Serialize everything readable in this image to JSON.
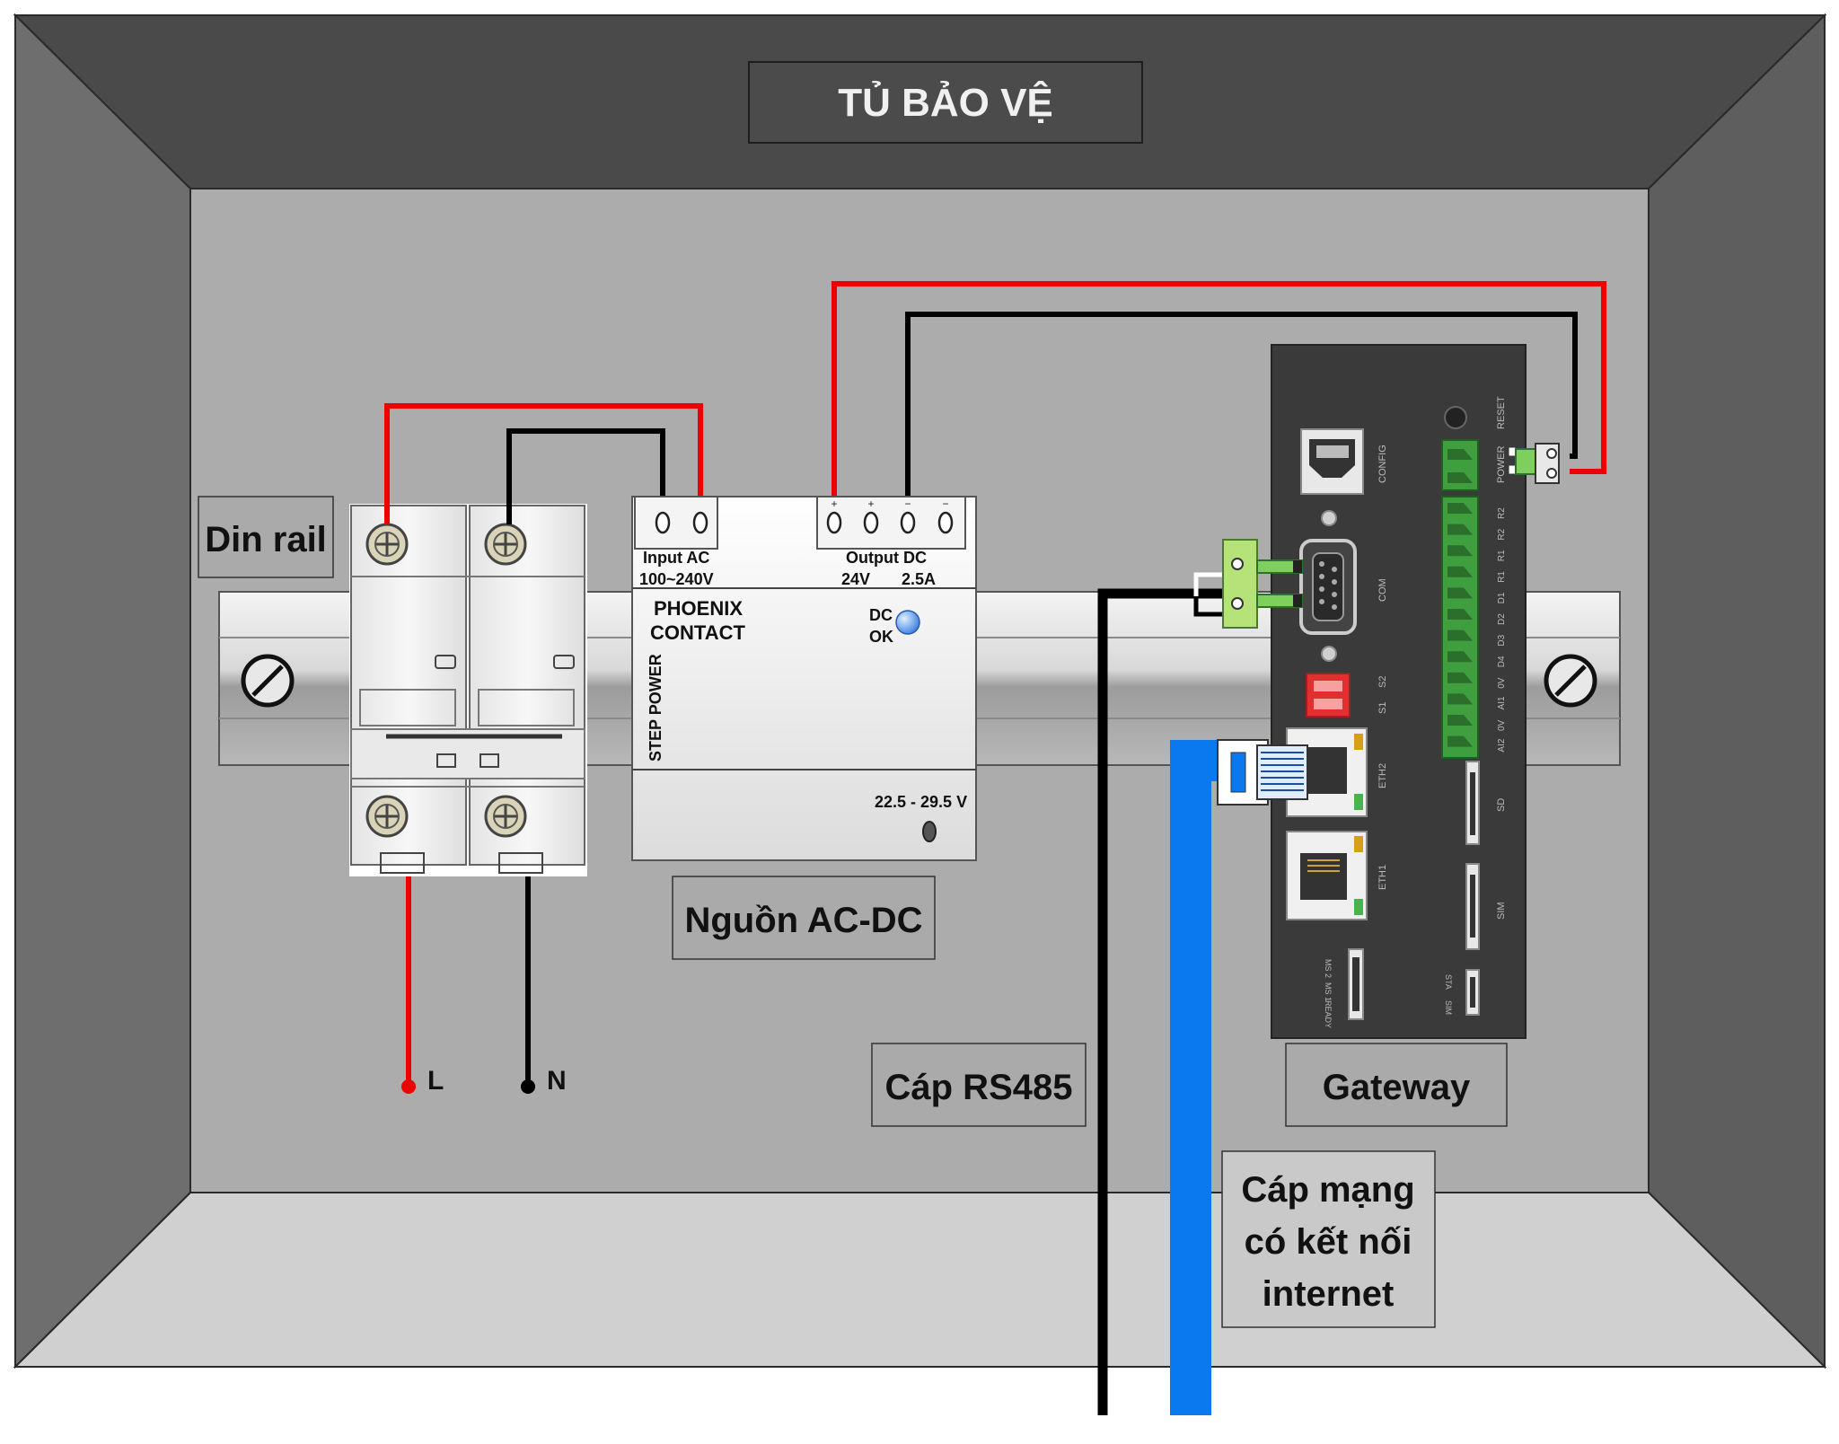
{
  "cabinet_title": "TỦ BẢO VỆ",
  "captions": {
    "din_rail": "Din rail",
    "power_supply": "Nguồn AC-DC",
    "rs485_cable": "Cáp RS485",
    "gateway": "Gateway",
    "network_cable_line1": "Cáp mạng",
    "network_cable_line2": "có kết nối",
    "network_cable_line3": "internet"
  },
  "terminals": {
    "live": "L",
    "neutral": "N"
  },
  "psu": {
    "input_label": "Input AC",
    "input_range": "100~240V",
    "output_label": "Output DC",
    "output_voltage": "24V",
    "output_current": "2.5A",
    "brand_line1": "PHOENIX",
    "brand_line2": "CONTACT",
    "series": "STEP POWER",
    "status_line1": "DC",
    "status_line2": "OK",
    "adjust_range": "22.5 - 29.5 V",
    "plus": "+",
    "minus": "−"
  },
  "gateway_labels": {
    "config": "CONFIG",
    "com": "COM",
    "s1": "S1",
    "s2": "S2",
    "eth2": "ETH2",
    "eth1": "ETH1",
    "reset": "RESET",
    "power": "POWER",
    "io": [
      "R2",
      "R2",
      "R1",
      "R1",
      "D1",
      "D2",
      "D3",
      "D4",
      "0V",
      "AI1",
      "0V",
      "AI2"
    ],
    "sd": "SD",
    "sim": "SIM",
    "ms2": "MS 2",
    "ms1": "MS 1",
    "ready": "READY",
    "sta": "STA",
    "sim_led": "SIM"
  },
  "colors": {
    "live_wire": "#ee0000",
    "neutral_wire": "#000000",
    "network_cable": "#0a78ee",
    "terminal_green": "#3f9f3f",
    "dc_ok_led": "#4a8ee8",
    "dip_switch": "#e03030"
  }
}
